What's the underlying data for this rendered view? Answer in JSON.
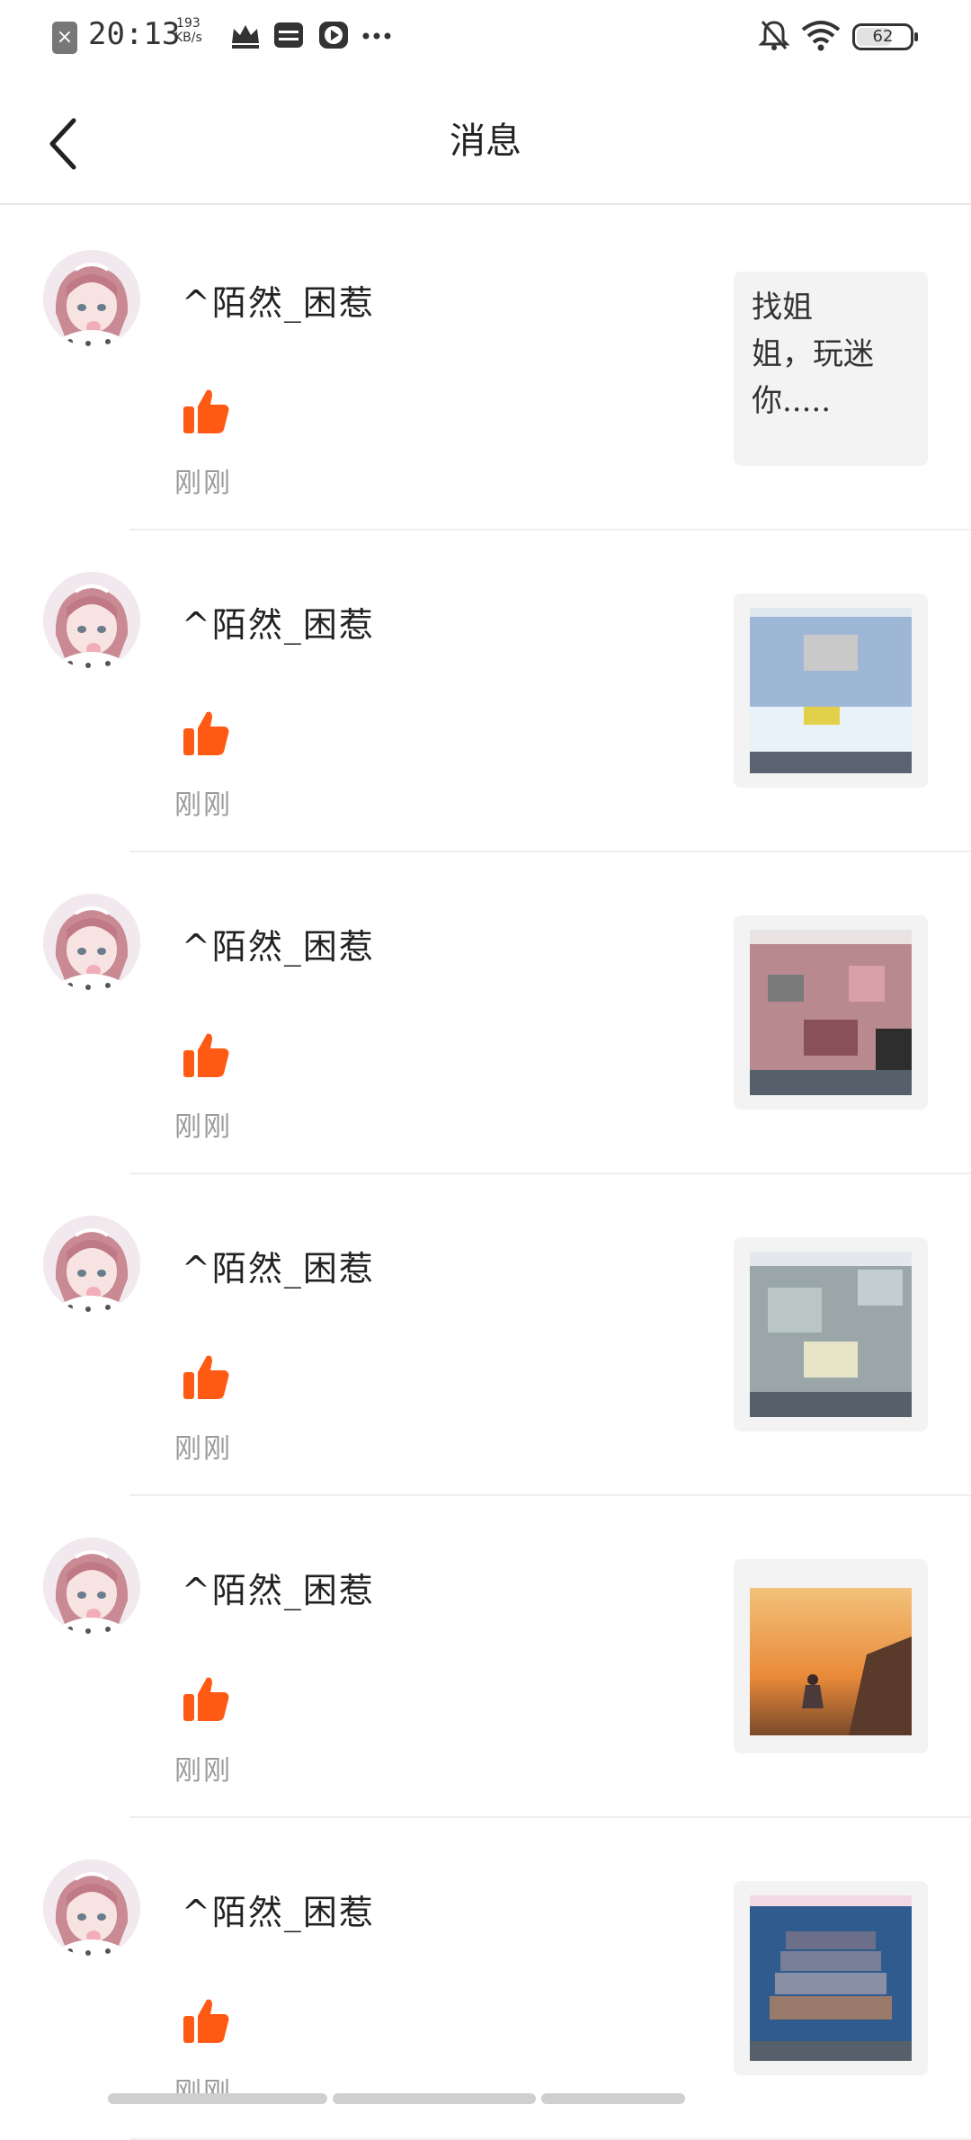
{
  "status_bar": {
    "time": "20:13",
    "speed_value": "193",
    "speed_unit": "KB/s",
    "battery": "62",
    "battery_level": 0.62,
    "icons": [
      "notification-close-icon",
      "crown-icon",
      "card-icon",
      "video-icon",
      "more-icon",
      "mute-bell-icon",
      "wifi-icon",
      "battery-icon"
    ]
  },
  "header": {
    "back_icon": "chevron-left-icon",
    "title": "消息"
  },
  "colors": {
    "like": "#ff5a14",
    "timestamp": "#9a9a9a",
    "thumb_bg": "#f3f3f3"
  },
  "messages": [
    {
      "user": "^陌然_困惹",
      "action_icon": "thumbs-up-icon",
      "time": "刚刚",
      "thumb_type": "text",
      "thumb_text": "找姐\n姐，玩迷\n你....."
    },
    {
      "user": "^陌然_困惹",
      "action_icon": "thumbs-up-icon",
      "time": "刚刚",
      "thumb_type": "image",
      "thumb_subject": "game-screenshot-sky"
    },
    {
      "user": "^陌然_困惹",
      "action_icon": "thumbs-up-icon",
      "time": "刚刚",
      "thumb_type": "image",
      "thumb_subject": "game-screenshot-blocks"
    },
    {
      "user": "^陌然_困惹",
      "action_icon": "thumbs-up-icon",
      "time": "刚刚",
      "thumb_type": "image",
      "thumb_subject": "game-screenshot-grey"
    },
    {
      "user": "^陌然_困惹",
      "action_icon": "thumbs-up-icon",
      "time": "刚刚",
      "thumb_type": "image",
      "thumb_subject": "sunset-photo"
    },
    {
      "user": "^陌然_困惹",
      "action_icon": "thumbs-up-icon",
      "time": "刚刚",
      "thumb_type": "image",
      "thumb_subject": "game-screenshot-stairs"
    }
  ]
}
